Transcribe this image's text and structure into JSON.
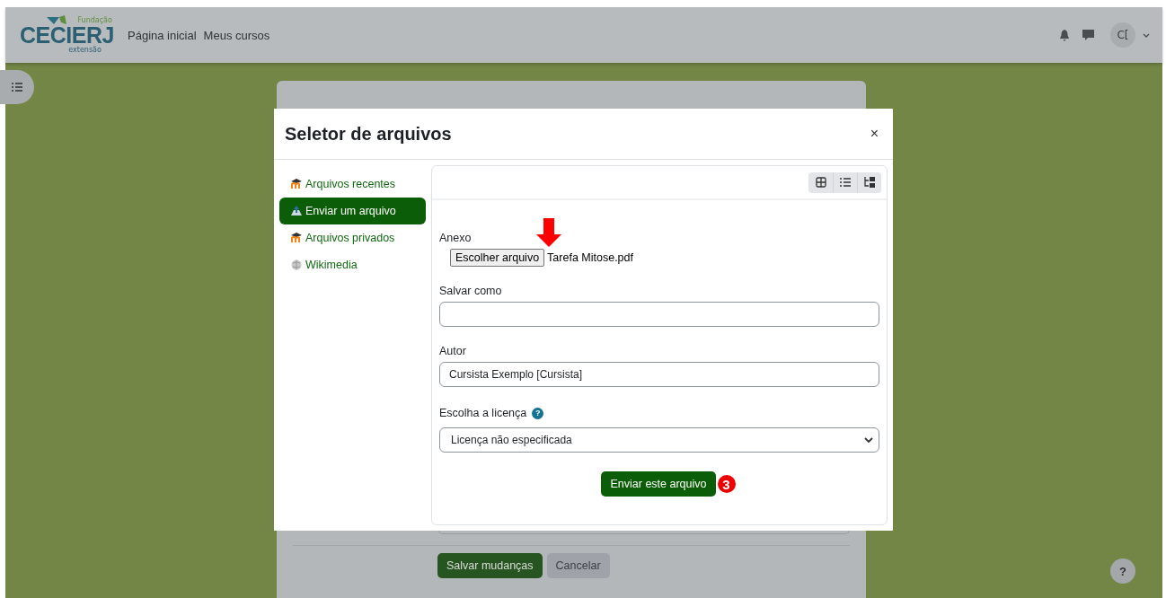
{
  "header": {
    "logo": {
      "top": "Fundação",
      "main": "CECIERJ",
      "sub": "extensão"
    },
    "nav": [
      {
        "label": "Página inicial"
      },
      {
        "label": "Meus cursos"
      }
    ],
    "avatar": "C["
  },
  "page": {
    "buttons": [
      {
        "label": "Salvar mudanças",
        "kind": "primary"
      },
      {
        "label": "Cancelar",
        "kind": "secondary"
      }
    ],
    "help": "?"
  },
  "dialog": {
    "title": "Seletor de arquivos",
    "close": "×",
    "repositories": [
      {
        "label": "Arquivos recentes",
        "kind": "moodle",
        "selected": false
      },
      {
        "label": "Enviar um arquivo",
        "kind": "upload",
        "selected": true
      },
      {
        "label": "Arquivos privados",
        "kind": "moodle",
        "selected": false
      },
      {
        "label": "Wikimedia",
        "kind": "wiki",
        "selected": false
      }
    ],
    "form": {
      "attachment": {
        "label": "Anexo",
        "button": "Escolher arquivo",
        "file": "Tarefa Mitose.pdf"
      },
      "save_as": {
        "label": "Salvar como"
      },
      "author": {
        "label": "Autor",
        "value": "Cursista Exemplo [Cursista]"
      },
      "license": {
        "label": "Escolha a licença",
        "help": "?",
        "value": "Licença não especificada"
      },
      "submit": "Enviar este arquivo",
      "step_badge": "3"
    }
  }
}
